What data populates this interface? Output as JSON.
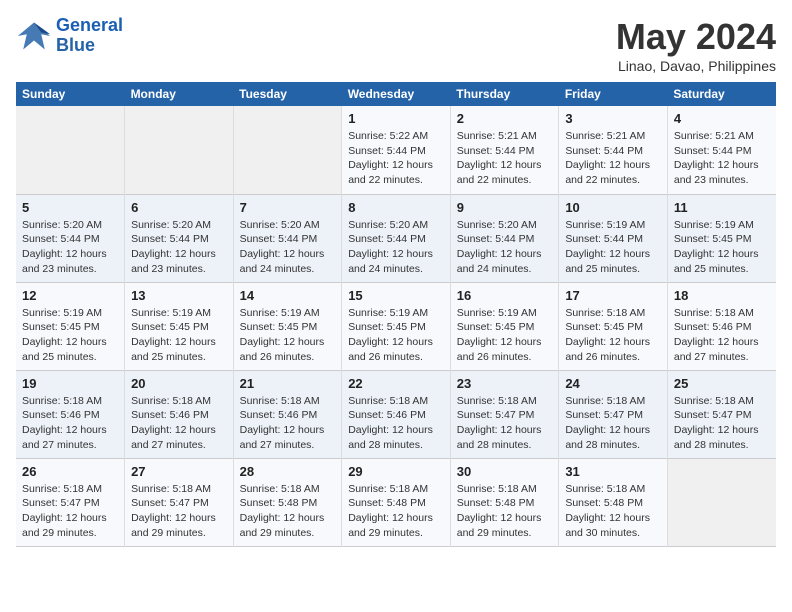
{
  "header": {
    "logo_line1": "General",
    "logo_line2": "Blue",
    "month": "May 2024",
    "location": "Linao, Davao, Philippines"
  },
  "weekdays": [
    "Sunday",
    "Monday",
    "Tuesday",
    "Wednesday",
    "Thursday",
    "Friday",
    "Saturday"
  ],
  "weeks": [
    [
      {
        "day": "",
        "info": ""
      },
      {
        "day": "",
        "info": ""
      },
      {
        "day": "",
        "info": ""
      },
      {
        "day": "1",
        "info": "Sunrise: 5:22 AM\nSunset: 5:44 PM\nDaylight: 12 hours\nand 22 minutes."
      },
      {
        "day": "2",
        "info": "Sunrise: 5:21 AM\nSunset: 5:44 PM\nDaylight: 12 hours\nand 22 minutes."
      },
      {
        "day": "3",
        "info": "Sunrise: 5:21 AM\nSunset: 5:44 PM\nDaylight: 12 hours\nand 22 minutes."
      },
      {
        "day": "4",
        "info": "Sunrise: 5:21 AM\nSunset: 5:44 PM\nDaylight: 12 hours\nand 23 minutes."
      }
    ],
    [
      {
        "day": "5",
        "info": "Sunrise: 5:20 AM\nSunset: 5:44 PM\nDaylight: 12 hours\nand 23 minutes."
      },
      {
        "day": "6",
        "info": "Sunrise: 5:20 AM\nSunset: 5:44 PM\nDaylight: 12 hours\nand 23 minutes."
      },
      {
        "day": "7",
        "info": "Sunrise: 5:20 AM\nSunset: 5:44 PM\nDaylight: 12 hours\nand 24 minutes."
      },
      {
        "day": "8",
        "info": "Sunrise: 5:20 AM\nSunset: 5:44 PM\nDaylight: 12 hours\nand 24 minutes."
      },
      {
        "day": "9",
        "info": "Sunrise: 5:20 AM\nSunset: 5:44 PM\nDaylight: 12 hours\nand 24 minutes."
      },
      {
        "day": "10",
        "info": "Sunrise: 5:19 AM\nSunset: 5:44 PM\nDaylight: 12 hours\nand 25 minutes."
      },
      {
        "day": "11",
        "info": "Sunrise: 5:19 AM\nSunset: 5:45 PM\nDaylight: 12 hours\nand 25 minutes."
      }
    ],
    [
      {
        "day": "12",
        "info": "Sunrise: 5:19 AM\nSunset: 5:45 PM\nDaylight: 12 hours\nand 25 minutes."
      },
      {
        "day": "13",
        "info": "Sunrise: 5:19 AM\nSunset: 5:45 PM\nDaylight: 12 hours\nand 25 minutes."
      },
      {
        "day": "14",
        "info": "Sunrise: 5:19 AM\nSunset: 5:45 PM\nDaylight: 12 hours\nand 26 minutes."
      },
      {
        "day": "15",
        "info": "Sunrise: 5:19 AM\nSunset: 5:45 PM\nDaylight: 12 hours\nand 26 minutes."
      },
      {
        "day": "16",
        "info": "Sunrise: 5:19 AM\nSunset: 5:45 PM\nDaylight: 12 hours\nand 26 minutes."
      },
      {
        "day": "17",
        "info": "Sunrise: 5:18 AM\nSunset: 5:45 PM\nDaylight: 12 hours\nand 26 minutes."
      },
      {
        "day": "18",
        "info": "Sunrise: 5:18 AM\nSunset: 5:46 PM\nDaylight: 12 hours\nand 27 minutes."
      }
    ],
    [
      {
        "day": "19",
        "info": "Sunrise: 5:18 AM\nSunset: 5:46 PM\nDaylight: 12 hours\nand 27 minutes."
      },
      {
        "day": "20",
        "info": "Sunrise: 5:18 AM\nSunset: 5:46 PM\nDaylight: 12 hours\nand 27 minutes."
      },
      {
        "day": "21",
        "info": "Sunrise: 5:18 AM\nSunset: 5:46 PM\nDaylight: 12 hours\nand 27 minutes."
      },
      {
        "day": "22",
        "info": "Sunrise: 5:18 AM\nSunset: 5:46 PM\nDaylight: 12 hours\nand 28 minutes."
      },
      {
        "day": "23",
        "info": "Sunrise: 5:18 AM\nSunset: 5:47 PM\nDaylight: 12 hours\nand 28 minutes."
      },
      {
        "day": "24",
        "info": "Sunrise: 5:18 AM\nSunset: 5:47 PM\nDaylight: 12 hours\nand 28 minutes."
      },
      {
        "day": "25",
        "info": "Sunrise: 5:18 AM\nSunset: 5:47 PM\nDaylight: 12 hours\nand 28 minutes."
      }
    ],
    [
      {
        "day": "26",
        "info": "Sunrise: 5:18 AM\nSunset: 5:47 PM\nDaylight: 12 hours\nand 29 minutes."
      },
      {
        "day": "27",
        "info": "Sunrise: 5:18 AM\nSunset: 5:47 PM\nDaylight: 12 hours\nand 29 minutes."
      },
      {
        "day": "28",
        "info": "Sunrise: 5:18 AM\nSunset: 5:48 PM\nDaylight: 12 hours\nand 29 minutes."
      },
      {
        "day": "29",
        "info": "Sunrise: 5:18 AM\nSunset: 5:48 PM\nDaylight: 12 hours\nand 29 minutes."
      },
      {
        "day": "30",
        "info": "Sunrise: 5:18 AM\nSunset: 5:48 PM\nDaylight: 12 hours\nand 29 minutes."
      },
      {
        "day": "31",
        "info": "Sunrise: 5:18 AM\nSunset: 5:48 PM\nDaylight: 12 hours\nand 30 minutes."
      },
      {
        "day": "",
        "info": ""
      }
    ]
  ]
}
